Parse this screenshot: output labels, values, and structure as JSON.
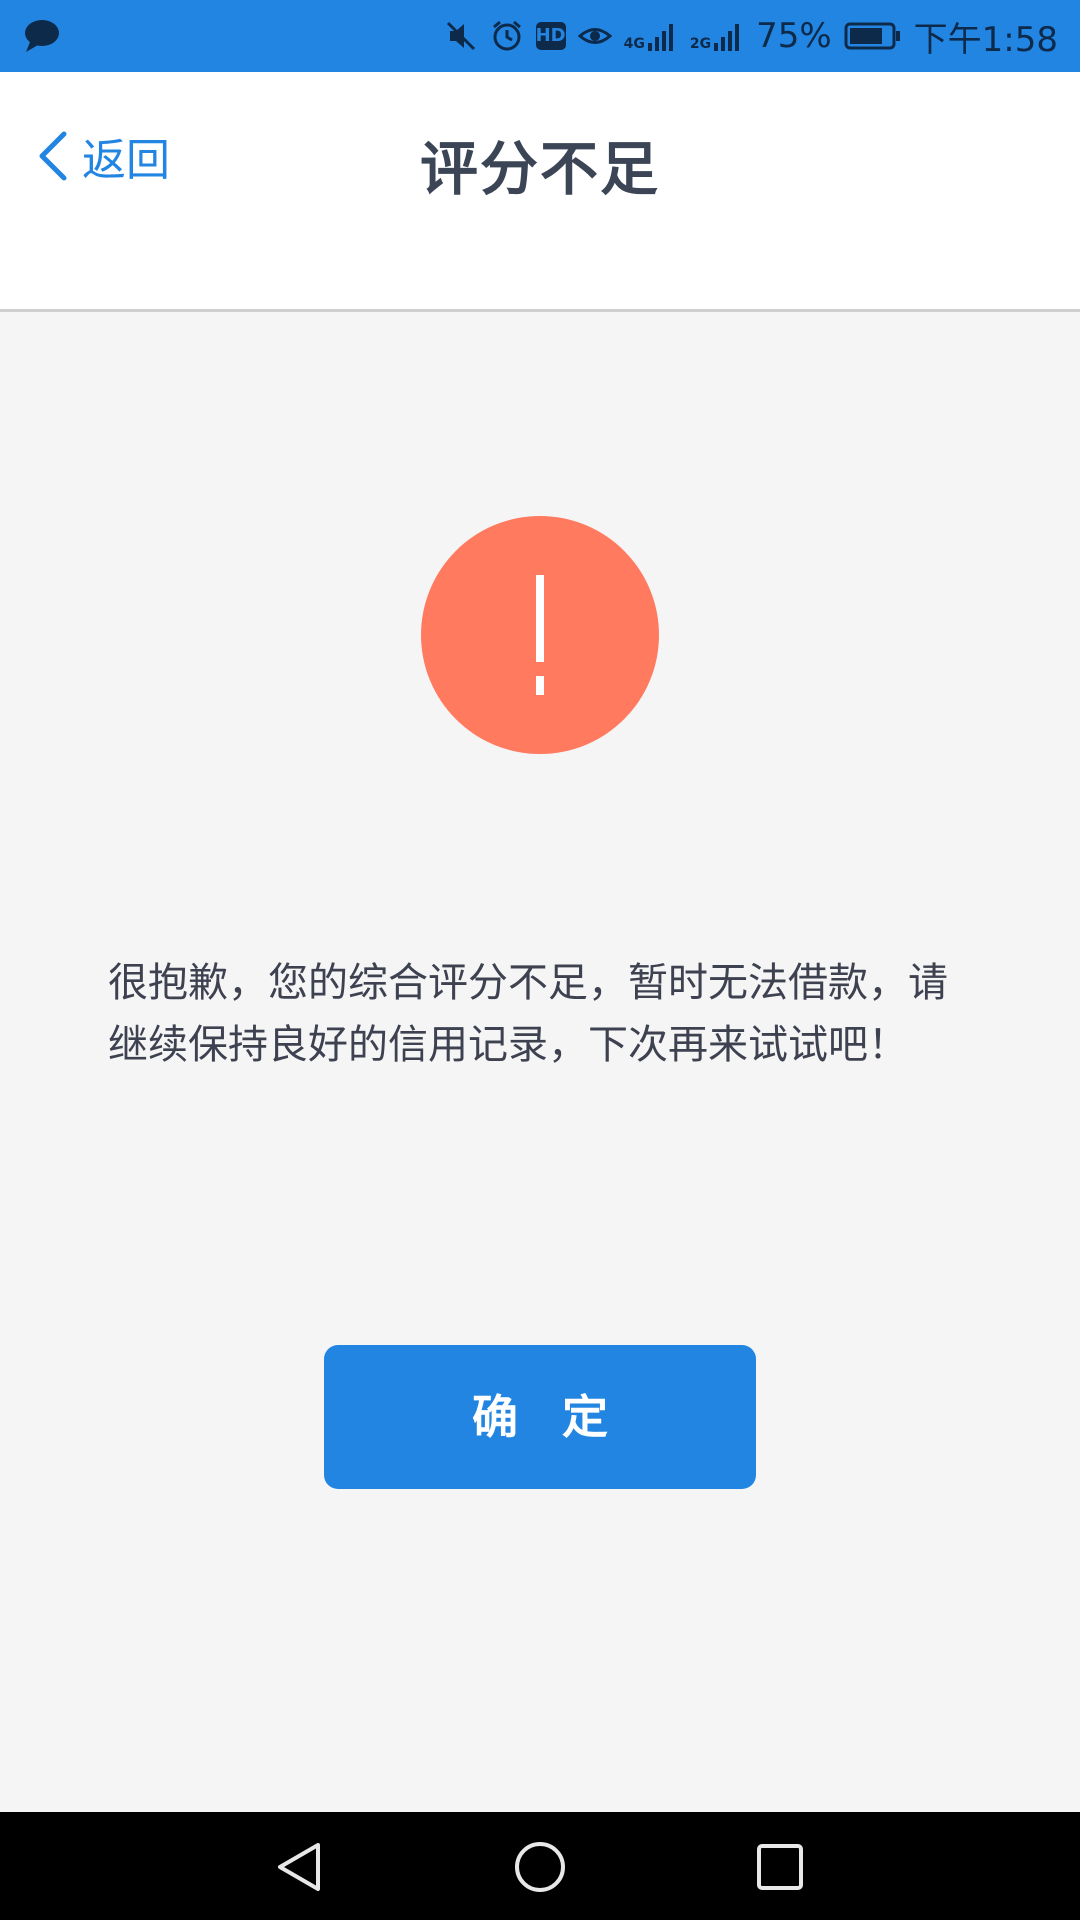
{
  "status_bar": {
    "network_4g": "4G",
    "network_2g": "2G",
    "battery_percent": "75%",
    "time": "下午1:58",
    "hd_badge": "HD",
    "icons": [
      "message-icon",
      "mute-icon",
      "alarm-icon",
      "hd-icon",
      "eye-icon",
      "signal-4g-icon",
      "signal-2g-icon",
      "battery-icon"
    ]
  },
  "header": {
    "back_label": "返回",
    "title": "评分不足"
  },
  "alert": {
    "icon": "exclamation-icon",
    "color": "#ff7a5e"
  },
  "message": {
    "text": "很抱歉，您的综合评分不足，暂时无法借款，请继续保持良好的信用记录，下次再来试试吧！"
  },
  "actions": {
    "confirm_label": "确 定"
  },
  "nav_bar": {
    "icons": [
      "back-triangle-icon",
      "home-circle-icon",
      "recents-square-icon"
    ]
  },
  "colors": {
    "accent": "#2285e2",
    "title_text": "#3b4556",
    "body_text": "#3e4250",
    "background": "#f5f5f6"
  }
}
